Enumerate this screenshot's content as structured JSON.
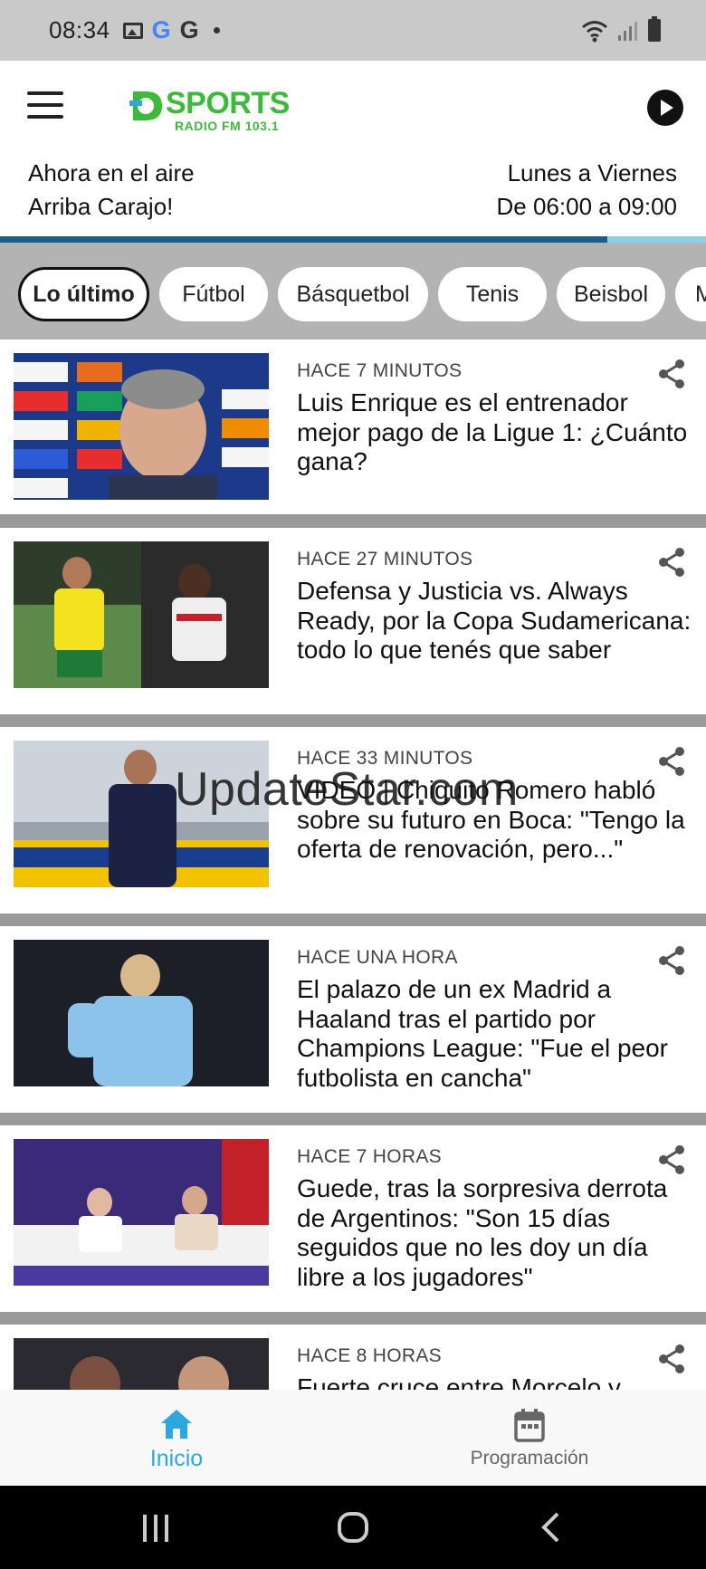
{
  "status_bar": {
    "time": "08:34",
    "icons": [
      "gallery-icon",
      "google-color-icon",
      "google-icon",
      "dot-icon",
      "wifi-icon",
      "signal-icon",
      "battery-icon"
    ]
  },
  "header": {
    "logo_text": "SPORTS",
    "logo_sub": "RADIO FM 103.1",
    "accent": "#3dba3a"
  },
  "on_air": {
    "label": "Ahora en el aire",
    "show": "Arriba Carajo!",
    "days": "Lunes a Viernes",
    "hours": "De 06:00 a 09:00",
    "progress_fraction": 0.86
  },
  "categories": [
    {
      "label": "Lo último",
      "active": true
    },
    {
      "label": "Fútbol",
      "active": false
    },
    {
      "label": "Básquetbol",
      "active": false
    },
    {
      "label": "Tenis",
      "active": false
    },
    {
      "label": "Beisbol",
      "active": false
    },
    {
      "label": "M",
      "active": false
    }
  ],
  "articles": [
    {
      "time": "HACE 7 MINUTOS",
      "title": "Luis Enrique es el entrenador mejor pago de la Ligue 1: ¿Cuánto gana?"
    },
    {
      "time": "HACE 27 MINUTOS",
      "title": "Defensa y Justicia vs. Always Ready, por la Copa Sudamericana: todo lo que tenés que saber"
    },
    {
      "time": "HACE 33 MINUTOS",
      "title": "VIDEO | Chiquito Romero habló sobre su futuro en Boca: \"Tengo la oferta de renovación, pero...\""
    },
    {
      "time": "HACE UNA HORA",
      "title": "El palazo de un ex Madrid a Haaland tras el partido por Champions League: \"Fue el peor futbolista en cancha\""
    },
    {
      "time": "HACE 7 HORAS",
      "title": "Guede, tras la sorpresiva derrota de Argentinos: \"Son 15 días seguidos que no les doy un día libre a los jugadores\""
    },
    {
      "time": "HACE 8 HORAS",
      "title": "Fuerte cruce entre Morcelo y"
    }
  ],
  "watermark": "UpdateStar.com",
  "bottom_nav": [
    {
      "label": "Inicio",
      "icon": "home-icon",
      "active": true
    },
    {
      "label": "Programación",
      "icon": "calendar-icon",
      "active": false
    }
  ],
  "colors": {
    "active_nav": "#2aa8df",
    "inactive_nav": "#666666",
    "progress_fill": "#1a5f8c",
    "progress_track": "#8bd0ea"
  }
}
